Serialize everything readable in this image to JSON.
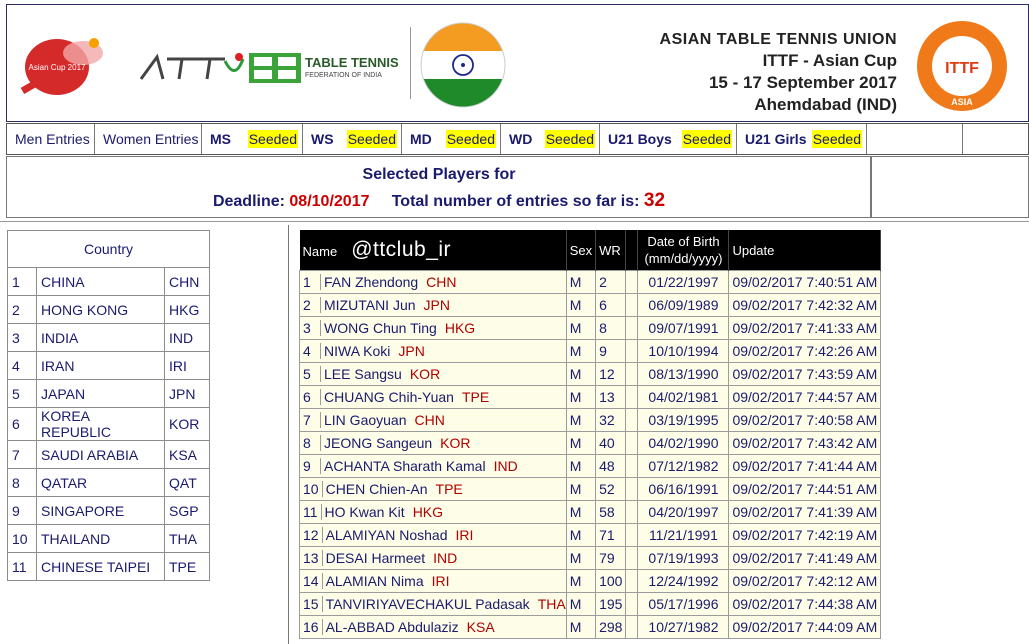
{
  "header": {
    "logo_asian_cup_text": "Asian Cup 2017",
    "attu_logo_text": "ATTU",
    "tt_federation_title": "TABLE TENNIS",
    "tt_federation_sub": "FEDERATION OF INDIA",
    "union_name": "ASIAN TABLE TENNIS UNION",
    "event_name": "ITTF - Asian Cup",
    "event_dates": "15 - 17 September 2017",
    "event_location": "Ahemdabad (IND)",
    "ittf_logo_text": "ITTF",
    "ittf_logo_sub": "ASIA"
  },
  "tabs": [
    {
      "label": "Men Entries"
    },
    {
      "label": "Women Entries"
    },
    {
      "label": "MS",
      "seeded": "Seeded"
    },
    {
      "label": "WS",
      "seeded": "Seeded"
    },
    {
      "label": "MD",
      "seeded": "Seeded"
    },
    {
      "label": "WD",
      "seeded": "Seeded"
    },
    {
      "label": "U21 Boys",
      "seeded": "Seeded"
    },
    {
      "label": "U21 Girls",
      "seeded": "Seeded"
    }
  ],
  "info": {
    "selected_label": "Selected Players for",
    "deadline_label": "Deadline:",
    "deadline_value": "08/10/2017",
    "total_label": "Total number of entries so far is:",
    "total_value": "32"
  },
  "country_table": {
    "header": "Country",
    "rows": [
      [
        "1",
        "CHINA",
        "CHN"
      ],
      [
        "2",
        "HONG KONG",
        "HKG"
      ],
      [
        "3",
        "INDIA",
        "IND"
      ],
      [
        "4",
        "IRAN",
        "IRI"
      ],
      [
        "5",
        "JAPAN",
        "JPN"
      ],
      [
        "6",
        "KOREA REPUBLIC",
        "KOR"
      ],
      [
        "7",
        "SAUDI ARABIA",
        "KSA"
      ],
      [
        "8",
        "QATAR",
        "QAT"
      ],
      [
        "9",
        "SINGAPORE",
        "SGP"
      ],
      [
        "10",
        "THAILAND",
        "THA"
      ],
      [
        "11",
        "CHINESE TAIPEI",
        "TPE"
      ]
    ]
  },
  "players_table": {
    "headers": {
      "name": "Name",
      "sex": "Sex",
      "wr": "WR",
      "dob": "Date of Birth",
      "dob_format": "(mm/dd/yyyy)",
      "update": "Update"
    },
    "watermark": "@ttclub_ir",
    "rows": [
      {
        "no": "1",
        "name": "FAN Zhendong",
        "country": "CHN",
        "sex": "M",
        "wr": "2",
        "dob": "01/22/1997",
        "update": "09/02/2017 7:40:51 AM"
      },
      {
        "no": "2",
        "name": "MIZUTANI Jun",
        "country": "JPN",
        "sex": "M",
        "wr": "6",
        "dob": "06/09/1989",
        "update": "09/02/2017 7:42:32 AM"
      },
      {
        "no": "3",
        "name": "WONG Chun Ting",
        "country": "HKG",
        "sex": "M",
        "wr": "8",
        "dob": "09/07/1991",
        "update": "09/02/2017 7:41:33 AM"
      },
      {
        "no": "4",
        "name": "NIWA Koki",
        "country": "JPN",
        "sex": "M",
        "wr": "9",
        "dob": "10/10/1994",
        "update": "09/02/2017 7:42:26 AM"
      },
      {
        "no": "5",
        "name": "LEE Sangsu",
        "country": "KOR",
        "sex": "M",
        "wr": "12",
        "dob": "08/13/1990",
        "update": "09/02/2017 7:43:59 AM"
      },
      {
        "no": "6",
        "name": "CHUANG Chih-Yuan",
        "country": "TPE",
        "sex": "M",
        "wr": "13",
        "dob": "04/02/1981",
        "update": "09/02/2017 7:44:57 AM"
      },
      {
        "no": "7",
        "name": "LIN Gaoyuan",
        "country": "CHN",
        "sex": "M",
        "wr": "32",
        "dob": "03/19/1995",
        "update": "09/02/2017 7:40:58 AM"
      },
      {
        "no": "8",
        "name": "JEONG Sangeun",
        "country": "KOR",
        "sex": "M",
        "wr": "40",
        "dob": "04/02/1990",
        "update": "09/02/2017 7:43:42 AM"
      },
      {
        "no": "9",
        "name": "ACHANTA Sharath Kamal",
        "country": "IND",
        "sex": "M",
        "wr": "48",
        "dob": "07/12/1982",
        "update": "09/02/2017 7:41:44 AM"
      },
      {
        "no": "10",
        "name": "CHEN Chien-An",
        "country": "TPE",
        "sex": "M",
        "wr": "52",
        "dob": "06/16/1991",
        "update": "09/02/2017 7:44:51 AM"
      },
      {
        "no": "11",
        "name": "HO Kwan Kit",
        "country": "HKG",
        "sex": "M",
        "wr": "58",
        "dob": "04/20/1997",
        "update": "09/02/2017 7:41:39 AM"
      },
      {
        "no": "12",
        "name": "ALAMIYAN Noshad",
        "country": "IRI",
        "sex": "M",
        "wr": "71",
        "dob": "11/21/1991",
        "update": "09/02/2017 7:42:19 AM"
      },
      {
        "no": "13",
        "name": "DESAI Harmeet",
        "country": "IND",
        "sex": "M",
        "wr": "79",
        "dob": "07/19/1993",
        "update": "09/02/2017 7:41:49 AM"
      },
      {
        "no": "14",
        "name": "ALAMIAN Nima",
        "country": "IRI",
        "sex": "M",
        "wr": "100",
        "dob": "12/24/1992",
        "update": "09/02/2017 7:42:12 AM"
      },
      {
        "no": "15",
        "name": "TANVIRIYAVECHAKUL Padasak",
        "country": "THA",
        "sex": "M",
        "wr": "195",
        "dob": "05/17/1996",
        "update": "09/02/2017 7:44:38 AM"
      },
      {
        "no": "16",
        "name": "AL-ABBAD Abdulaziz",
        "country": "KSA",
        "sex": "M",
        "wr": "298",
        "dob": "10/27/1982",
        "update": "09/02/2017 7:44:09 AM"
      }
    ]
  },
  "colors": {
    "accent_red": "#cc0000",
    "seeded_yellow": "#ffff00",
    "header_black": "#000000",
    "row_bg": "#fdfde8",
    "text_navy": "#1a1a6e"
  }
}
